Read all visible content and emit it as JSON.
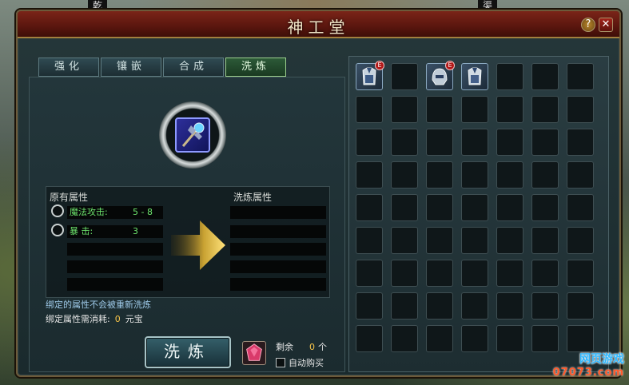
{
  "window": {
    "title": "神工堂",
    "help_label": "?",
    "close_label": "✕"
  },
  "tabs": [
    {
      "label": "强化",
      "active": false
    },
    {
      "label": "镶嵌",
      "active": false
    },
    {
      "label": "合成",
      "active": false
    },
    {
      "label": "洗炼",
      "active": true
    }
  ],
  "attributes": {
    "original_header": "原有属性",
    "new_header": "洗炼属性",
    "original": [
      {
        "name": "魔法攻击:",
        "value": "5 - 8"
      },
      {
        "name": "暴        击:",
        "value": "3"
      }
    ]
  },
  "notes": {
    "bound_note": "绑定的属性不会被重新洗炼",
    "cost_label": "绑定属性需消耗:",
    "cost_value": "0",
    "cost_unit": "元宝"
  },
  "action": {
    "wash_button": "洗炼",
    "remain_label": "剩余",
    "remain_count": "0",
    "remain_unit": "个",
    "auto_buy_label": "自动购买"
  },
  "inventory": {
    "slots": [
      {
        "item": "armor-icon",
        "badge": "E"
      },
      {
        "item": null
      },
      {
        "item": "helmet-icon",
        "badge": "E"
      },
      {
        "item": "armor-icon-2",
        "badge": ""
      }
    ]
  },
  "background": {
    "top_left_label": "乾",
    "top_right_label": "渠"
  },
  "watermark": {
    "line1": "网页游戏",
    "line2": "07073.com"
  }
}
